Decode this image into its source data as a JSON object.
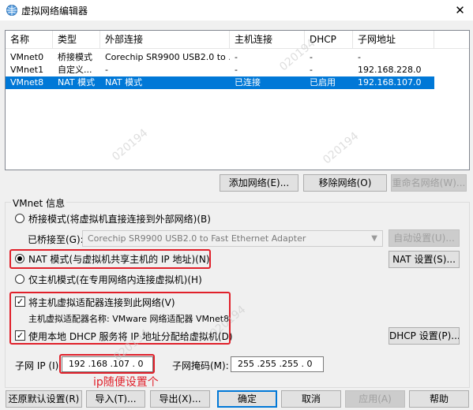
{
  "window": {
    "title": "虚拟网络编辑器",
    "close_glyph": "✕"
  },
  "table": {
    "columns": [
      "名称",
      "类型",
      "外部连接",
      "主机连接",
      "DHCP",
      "子网地址"
    ],
    "rows": [
      {
        "name": "VMnet0",
        "type": "桥接模式",
        "external": "Corechip SR9900 USB2.0 to ...",
        "host": "-",
        "dhcp": "-",
        "subnet": "-",
        "selected": false
      },
      {
        "name": "VMnet1",
        "type": "自定义...",
        "external": "-",
        "host": "-",
        "dhcp": "-",
        "subnet": "192.168.228.0",
        "selected": false
      },
      {
        "name": "VMnet8",
        "type": "NAT 模式",
        "external": "NAT 模式",
        "host": "已连接",
        "dhcp": "已启用",
        "subnet": "192.168.107.0",
        "selected": true
      }
    ]
  },
  "table_buttons": {
    "add": "添加网络(E)...",
    "remove": "移除网络(O)",
    "rename": "重命名网络(W)..."
  },
  "vmnet_info": {
    "group_title": "VMnet 信息",
    "bridged_label": "桥接模式(将虚拟机直接连接到外部网络)(B)",
    "bridged_to_label": "已桥接至(G):",
    "bridged_to_value": "Corechip SR9900 USB2.0 to Fast Ethernet Adapter",
    "auto_settings": "自动设置(U)...",
    "nat_label": "NAT 模式(与虚拟机共享主机的 IP 地址)(N)",
    "nat_settings": "NAT 设置(S)...",
    "hostonly_label": "仅主机模式(在专用网络内连接虚拟机)(H)",
    "connect_adapter_label": "将主机虚拟适配器连接到此网络(V)",
    "adapter_name_label": "主机虚拟适配器名称: VMware 网络适配器 VMnet8",
    "use_dhcp_label": "使用本地 DHCP 服务将 IP 地址分配给虚拟机(D)",
    "dhcp_settings": "DHCP 设置(P)...",
    "subnet_ip_label": "子网 IP (I):",
    "subnet_ip_value": "192 .168 .107 . 0",
    "subnet_mask_label": "子网掩码(M):",
    "subnet_mask_value": "255 .255 .255 . 0",
    "selected_mode": "nat",
    "connect_adapter_checked": true,
    "use_dhcp_checked": true
  },
  "annotation_text": "ip随便设置个",
  "watermarks": [
    "020194",
    "020194",
    "020194",
    "020194",
    "020194"
  ],
  "footer_buttons": {
    "restore": "还原默认设置(R)",
    "import": "导入(T)...",
    "export": "导出(X)...",
    "ok": "确定",
    "cancel": "取消",
    "apply": "应用(A)",
    "help": "帮助"
  },
  "colors": {
    "selection": "#0078d7",
    "annotation_red": "#e0202a"
  }
}
